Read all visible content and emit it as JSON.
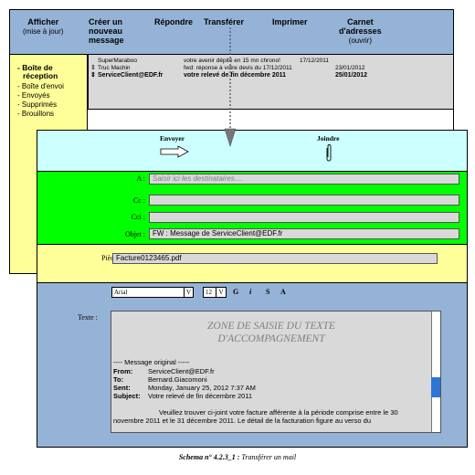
{
  "toolbar": {
    "afficher": "Afficher",
    "afficher_sub": "(mise à jour)",
    "creer_1": "Créer un",
    "creer_2": "nouveau",
    "creer_3": "message",
    "repondre": "Répondre",
    "transferer": "Transférer",
    "imprimer": "Imprimer",
    "carnet_1": "Carnet",
    "carnet_2": "d'adresses",
    "carnet_sub": "(ouvrir)"
  },
  "sidebar": {
    "items": [
      "- Boîte de",
      "réception",
      "- Boîte d'envoi",
      "- Envoyés",
      "- Supprimés",
      "- Brouillons"
    ]
  },
  "messages": [
    {
      "from": "SuperMaraboo",
      "subject": "votre avenir dépité en 15 mn chrono!",
      "date": "17/12/2011"
    },
    {
      "from": "Truc Machin",
      "subject": "fwd: réponse à votre devis du 17/12/2011",
      "date": "23/01/2012"
    },
    {
      "from": "ServiceClient@EDF.fr",
      "subject": "votre relevé de fin décembre 2011",
      "date": "25/01/2012"
    }
  ],
  "compose": {
    "envoyer": "Envoyer",
    "joindre": "Joindre",
    "a_label": "A :",
    "a_placeholder": "Saisir ici les destinataires....",
    "cc_label": "Cc :",
    "cci_label": "Cci :",
    "objet_label": "Objet :",
    "objet_value": "FW : Message de ServiceClient@EDF.fr",
    "pj_label": "Pièces jointes :",
    "pj_value": "Facture0123465.pdf",
    "font_name": "Arial",
    "font_dd": "V",
    "font_size": "12",
    "size_dd": "V",
    "bold": "G",
    "italic": "i",
    "strike": "S",
    "underline": "A",
    "texte_label": "Texte :",
    "zone_1": "ZONE DE SAISIE DU TEXTE",
    "zone_2": "D'ACCOMPAGNEMENT",
    "orig_header": "---- Message original -----",
    "from_label": "From:",
    "from_value": "ServiceClient@EDF.fr",
    "to_label": "To:",
    "to_value": "Bernard.Giacomoni",
    "sent_label": "Sent:",
    "sent_value": "Monday, January 25, 2012 7:37 AM",
    "subject_label": "Subject:",
    "subject_value": "Votre relevé de fin décembre 2011",
    "body_1": "Veuillez trouver ci-joint votre facture afférente à la période comprise entre le 30",
    "body_2": "novembre 2011 et le 31 décembre 2011. Le détail de la facturation figure au verso du"
  },
  "caption": {
    "prefix": "Schema n° 4.2.3_1 :",
    "text": " Transférer un mail"
  }
}
